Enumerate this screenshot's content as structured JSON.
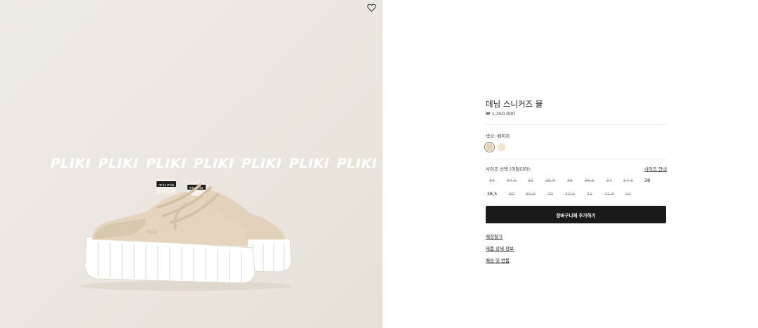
{
  "gallery": {
    "watermark": [
      "PLIKI",
      "PLIKI",
      "PLIKI",
      "PLIKI",
      "PLIKI",
      "PLIKI",
      "PLIKI"
    ],
    "wishlist_icon": "heart-icon"
  },
  "product": {
    "title": "데님 스니커즈 뮬",
    "price": "₩ 1,350,000"
  },
  "color": {
    "label": "색상:  베이지",
    "swatches": [
      {
        "name": "베이지",
        "hex": "#e7d3b9",
        "selected": true
      },
      {
        "name": "light",
        "hex": "#f3e3cf",
        "selected": false
      }
    ]
  },
  "size": {
    "label": "사이즈 선택 (이탈리아):",
    "guide_label": "사이즈 안내",
    "options": [
      {
        "label": "34",
        "available": false
      },
      {
        "label": "34,5",
        "available": false
      },
      {
        "label": "35",
        "available": false
      },
      {
        "label": "35,5",
        "available": false
      },
      {
        "label": "36",
        "available": false
      },
      {
        "label": "36,5",
        "available": false
      },
      {
        "label": "37",
        "available": false
      },
      {
        "label": "37,5",
        "available": false
      },
      {
        "label": "38",
        "available": true
      },
      {
        "label": "38,5",
        "available": true
      },
      {
        "label": "39",
        "available": false
      },
      {
        "label": "39,5",
        "available": false
      },
      {
        "label": "40",
        "available": false
      },
      {
        "label": "40,5",
        "available": false
      },
      {
        "label": "41",
        "available": false
      },
      {
        "label": "41,5",
        "available": false
      },
      {
        "label": "42",
        "available": false
      }
    ]
  },
  "actions": {
    "add_to_cart": "장바구니에 추가하기"
  },
  "links": [
    "매장찾기",
    "제품 상세 정보",
    "배송 및 반품"
  ]
}
